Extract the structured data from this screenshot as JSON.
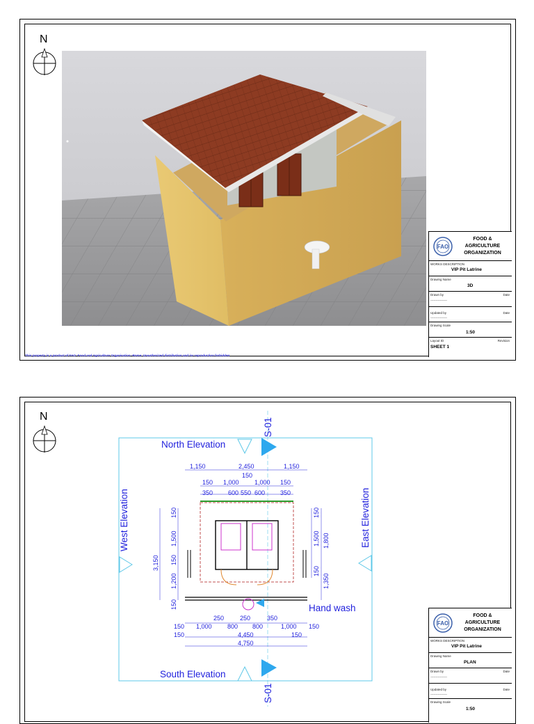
{
  "sheet1": {
    "north_label": "N",
    "title_block": {
      "org_line1": "FOOD &",
      "org_line2": "AGRICULTURE",
      "org_line3": "ORGANIZATION",
      "works_label": "WORKS DESCRIPTION",
      "works_value": "VIP Pit Latrine",
      "drawing_name_label": "Drawing Name",
      "drawing_name_value": "3D",
      "drawn_by_label": "Drawn by",
      "date_label": "Date",
      "dashes": "----------------",
      "updated_by_label": "Updated by",
      "date_label2": "Date",
      "dashes2": "----------------",
      "scale_label": "Drawing Scale",
      "scale_value": "1:50",
      "layout_label": "Layout ID",
      "revision_label": "Revision",
      "layout_value": "SHEET 1"
    },
    "copyright": "This property is a product of FAO -Food and Agriculture Organisation -Rome. Unauthorized distribution and /or reproduction forbidden"
  },
  "sheet2": {
    "north_label": "N",
    "section_top": "S-01",
    "section_bottom": "S-01",
    "north_elevation": "North Elevation",
    "south_elevation": "South Elevation",
    "west_elevation": "West Elevation",
    "east_elevation": "East Elevation",
    "hand_wash": "Hand wash",
    "dims": {
      "top1": [
        "1,150",
        "2,450",
        "1,150"
      ],
      "top2": [
        "150"
      ],
      "top3": [
        "150",
        "1,000",
        "1,000",
        "150"
      ],
      "top4": [
        "350",
        "600",
        "550",
        "600",
        "350"
      ],
      "bot1": [
        "250",
        "250",
        "350"
      ],
      "bot2": [
        "150",
        "1,000",
        "800",
        "800",
        "1,000",
        "150"
      ],
      "bot3": [
        "150",
        "4,450",
        "150"
      ],
      "bot4": [
        "4,750"
      ],
      "left_outer": "3,150",
      "left_inner": [
        "150",
        "1,500",
        "150",
        "1,200",
        "150"
      ],
      "right_inner": [
        "150",
        "1,500",
        "150"
      ],
      "right_outer": [
        "1,800",
        "1,350"
      ]
    },
    "title_block": {
      "org_line1": "FOOD &",
      "org_line2": "AGRICULTURE",
      "org_line3": "ORGANIZATION",
      "works_label": "WORKS DESCRIPTION",
      "works_value": "VIP Pit Latrine",
      "drawing_name_label": "Drawing Name",
      "drawing_name_value": "PLAN",
      "drawn_by_label": "Drawn by",
      "date_label": "Date",
      "dashes": "----------------",
      "updated_by_label": "Updated by",
      "date_label2": "Date",
      "dashes2": "----------------",
      "scale_label": "Drawing Scale",
      "scale_value": "1:50"
    }
  },
  "colors": {
    "annotation_blue": "#2222dd",
    "elevation_box": "#5ec8e8",
    "wall_yellow": "#e8c46a",
    "roof_tile": "#8a3a22"
  }
}
